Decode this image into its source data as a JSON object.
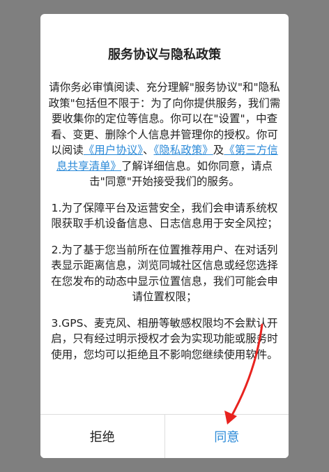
{
  "dialog": {
    "title": "服务协议与隐私政策",
    "intro_part1": "请你务必审慎阅读、充分理解\"服务协议\"和\"隐私政策\"包括但不限于：为了向你提供服务，我们需要收集你的定位等信息。你可以在\"设置\"，中查看、变更、删除个人信息并管理你的授权。你可以阅读",
    "link_user_agreement": "《用户协议》",
    "separator": "、",
    "link_privacy_policy": "《隐私政策》",
    "and": "及",
    "link_third_party": "《第三方信息共享清单》",
    "intro_part2": "了解详细信息。如你同意，请点击\"同意\"开始接受我们的服务。",
    "item1": "1.为了保障平台及运营安全，我们会申请系统权限获取手机设备信息、日志信息用于安全风控；",
    "item2": "2.为了基于您当前所在位置推荐用户、在对话列表显示距离信息，浏览同城社区信息或经您选择在您发布的动态中显示位置信息，我们可能会申请位置权限；",
    "item3": "3.GPS、麦克风、相册等敏感权限均不会默认开启，只有经过明示授权才会为实现功能或服务时使用，您均可以拒绝且不影响您继续使用软件。"
  },
  "buttons": {
    "reject_label": "拒绝",
    "agree_label": "同意"
  },
  "colors": {
    "link": "#2b8ad8",
    "annotation_arrow": "#e8231f",
    "overlay": "#7f7f7f"
  }
}
